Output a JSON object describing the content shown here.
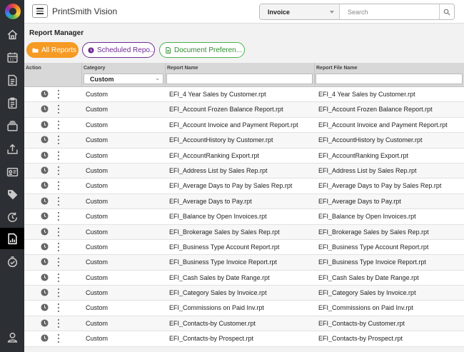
{
  "app": {
    "title": "PrintSmith Vision"
  },
  "search": {
    "scope": "Invoice",
    "placeholder": "Search"
  },
  "page": {
    "title": "Report Manager"
  },
  "tabs": [
    {
      "label": "All Reports"
    },
    {
      "label": "Scheduled Repo..."
    },
    {
      "label": "Document Preferen..."
    }
  ],
  "grid": {
    "columns": {
      "action": "Action",
      "category": "Category",
      "report_name": "Report Name",
      "report_file": "Report File Name"
    },
    "category_filter": "Custom",
    "rows": [
      {
        "category": "Custom",
        "name": "EFI_4 Year Sales by Customer.rpt",
        "file": "EFI_4 Year Sales by Customer.rpt"
      },
      {
        "category": "Custom",
        "name": "EFI_Account Frozen Balance Report.rpt",
        "file": "EFI_Account Frozen Balance Report.rpt"
      },
      {
        "category": "Custom",
        "name": "EFI_Account Invoice and Payment Report.rpt",
        "file": "EFI_Account Invoice and Payment Report.rpt"
      },
      {
        "category": "Custom",
        "name": "EFI_AccountHistory by Customer.rpt",
        "file": "EFI_AccountHistory by Customer.rpt"
      },
      {
        "category": "Custom",
        "name": "EFI_AccountRanking Export.rpt",
        "file": "EFI_AccountRanking Export.rpt"
      },
      {
        "category": "Custom",
        "name": "EFI_Address List by Sales Rep.rpt",
        "file": "EFI_Address List by Sales Rep.rpt"
      },
      {
        "category": "Custom",
        "name": "EFI_Average Days to Pay by Sales Rep.rpt",
        "file": "EFI_Average Days to Pay by Sales Rep.rpt"
      },
      {
        "category": "Custom",
        "name": "EFI_Average Days to Pay.rpt",
        "file": "EFI_Average Days to Pay.rpt"
      },
      {
        "category": "Custom",
        "name": "EFI_Balance by Open Invoices.rpt",
        "file": "EFI_Balance by Open Invoices.rpt"
      },
      {
        "category": "Custom",
        "name": "EFI_Brokerage Sales by Sales Rep.rpt",
        "file": "EFI_Brokerage Sales by Sales Rep.rpt"
      },
      {
        "category": "Custom",
        "name": "EFI_Business Type Account Report.rpt",
        "file": "EFI_Business Type Account Report.rpt"
      },
      {
        "category": "Custom",
        "name": "EFI_Business Type Invoice Report.rpt",
        "file": "EFI_Business Type Invoice Report.rpt"
      },
      {
        "category": "Custom",
        "name": "EFI_Cash Sales by Date Range.rpt",
        "file": "EFI_Cash Sales by Date Range.rpt"
      },
      {
        "category": "Custom",
        "name": "EFI_Category Sales by Invoice.rpt",
        "file": "EFI_Category Sales by Invoice.rpt"
      },
      {
        "category": "Custom",
        "name": "EFI_Commissions on Paid Inv.rpt",
        "file": "EFI_Commissions on Paid Inv.rpt"
      },
      {
        "category": "Custom",
        "name": "EFI_Contacts-by Customer.rpt",
        "file": "EFI_Contacts-by Customer.rpt"
      },
      {
        "category": "Custom",
        "name": "EFI_Contacts-by Prospect.rpt",
        "file": "EFI_Contacts-by Prospect.rpt"
      }
    ]
  },
  "icons": {
    "sidebar": [
      "home-icon",
      "calendar-icon",
      "invoice-icon",
      "clipboard-icon",
      "stack-icon",
      "upload-icon",
      "id-card-icon",
      "tag-icon",
      "sync-icon",
      "reports-icon",
      "schedule-check-icon",
      "user-settings-icon"
    ],
    "row_actions": [
      "schedule-clock-icon",
      "more-vertical-icon"
    ]
  },
  "colors": {
    "sidebar": "#2c2f33",
    "accent_orange": "#f59a23",
    "purple": "#6b2c91",
    "green": "#4caf50"
  }
}
